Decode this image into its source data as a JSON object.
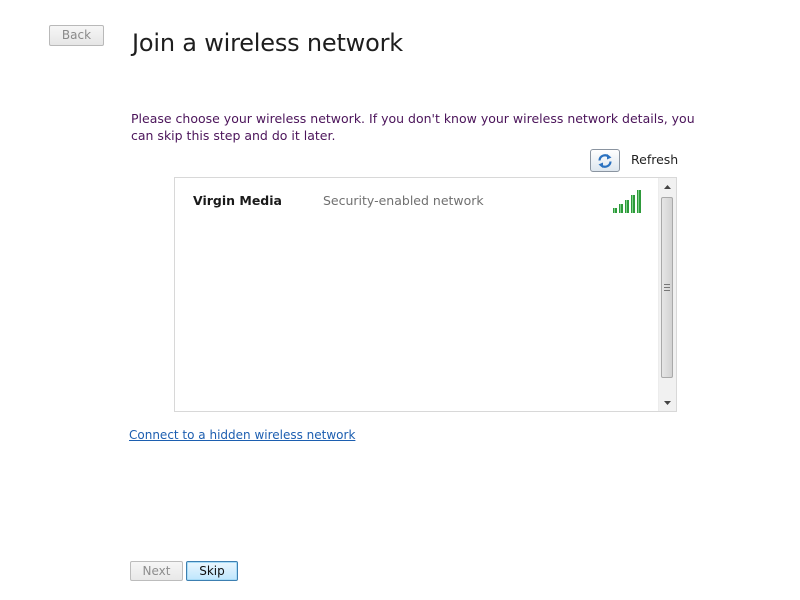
{
  "header": {
    "back_label": "Back",
    "title": "Join a wireless network"
  },
  "instructions": "Please choose your wireless network. If you don't know your wireless network details, you can skip this step and do it later.",
  "refresh": {
    "icon": "refresh-icon",
    "label": "Refresh"
  },
  "networks": [
    {
      "name": "Virgin Media",
      "security": "Security-enabled network",
      "signal_bars": 5,
      "signal_max": 5,
      "signal_color": "#2e9a3b"
    }
  ],
  "hidden_network_link": "Connect to a hidden wireless network",
  "footer": {
    "next_label": "Next",
    "skip_label": "Skip"
  },
  "colors": {
    "instruction_text": "#4b145a",
    "link": "#1c5eb0",
    "default_button_border": "#3c7fb1"
  }
}
